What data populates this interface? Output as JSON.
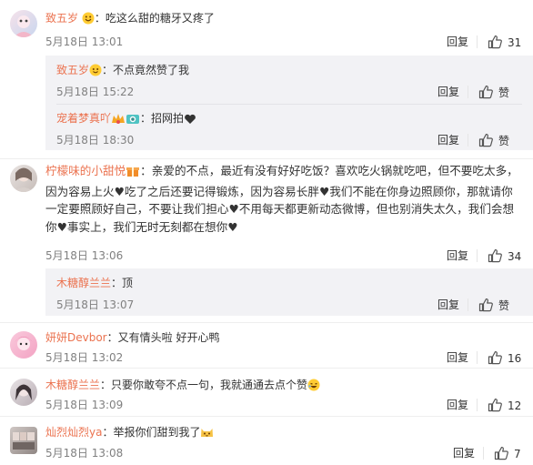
{
  "reply_label": "回复",
  "like_label": "赞",
  "comments": [
    {
      "name": "致五岁",
      "text": "：吃这么甜的糖牙又疼了",
      "time": "5月18日 13:01",
      "likes": "31"
    },
    {
      "name": "柠檬味的小甜悦",
      "text": "：亲爱的不点，最近有没有好好吃饭？喜欢吃火锅就吃吧，但不要吃太多，因为容易上火♥吃了之后还要记得锻炼，因为容易长胖♥我们不能在你身边照顾你，那就请你一定要照顾好自己，不要让我们担心♥不用每天都更新动态微博，但也别消失太久，我们会想你♥事实上，我们无时无刻都在想你♥",
      "time": "5月18日 13:06",
      "likes": "34"
    },
    {
      "name": "妍妍Devbor",
      "text": "：又有情头啦 好开心鸭",
      "time": "5月18日 13:02",
      "likes": "16"
    },
    {
      "name": "木糖醇兰兰",
      "text": "：只要你敢夸不点一句，我就通通去点个赞",
      "time": "5月18日 13:09",
      "likes": "12"
    },
    {
      "name": "灿烈灿烈ya",
      "text": "：举报你们甜到我了",
      "time": "5月18日 13:08",
      "likes": "7"
    }
  ],
  "replies": [
    {
      "name": "致五岁",
      "text": "：不点竟然赞了我",
      "time": "5月18日 15:22"
    },
    {
      "name": "宠着梦真吖",
      "text": "：招网拍",
      "time": "5月18日 18:30"
    },
    {
      "name": "木糖醇兰兰",
      "text": "：顶",
      "time": "5月18日 13:07"
    }
  ]
}
